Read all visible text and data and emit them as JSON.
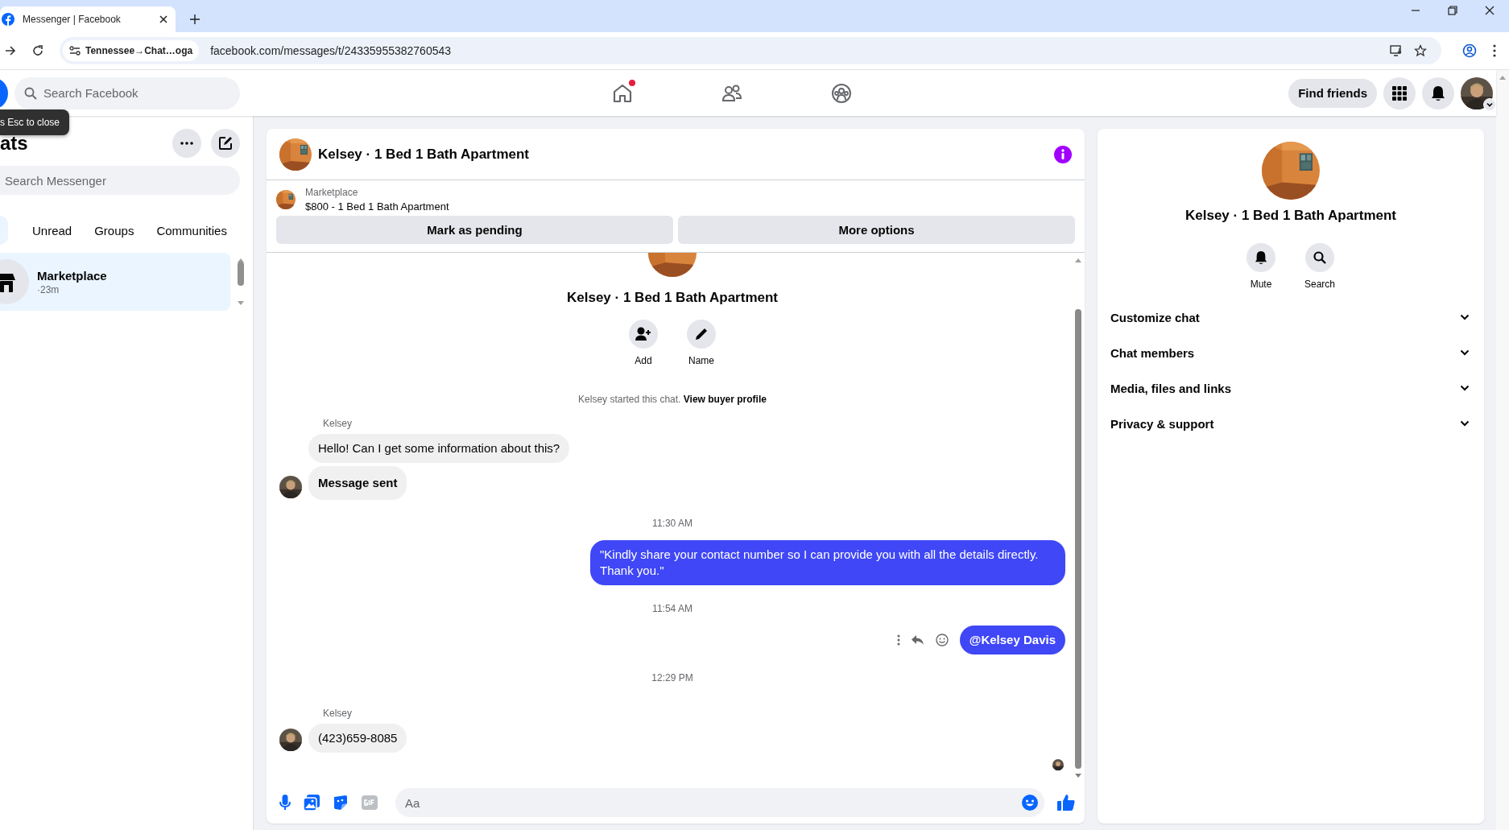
{
  "browser": {
    "tab_title": "Messenger | Facebook",
    "site_chip": "Tennessee→Chat…oga",
    "url": "facebook.com/messages/t/24335955382760543"
  },
  "topbar": {
    "search_placeholder": "Search Facebook",
    "nav": [
      {
        "kind": "home",
        "badge": true
      },
      {
        "kind": "friends",
        "badge": false
      },
      {
        "kind": "groups",
        "badge": false
      }
    ],
    "find_friends": "Find friends"
  },
  "tooltip": "s Esc to close",
  "sidebar": {
    "title": "ats",
    "search_placeholder": "Search Messenger",
    "filters": [
      "Unread",
      "Groups",
      "Communities"
    ],
    "chats": [
      {
        "name": "Marketplace",
        "meta": "·23m",
        "selected": true
      }
    ]
  },
  "conversation": {
    "title": "Kelsey · 1 Bed 1 Bath Apartment",
    "listing": {
      "source": "Marketplace",
      "title": "$800 - 1 Bed 1 Bath Apartment"
    },
    "actions": [
      "Mark as pending",
      "More options"
    ],
    "profile": {
      "name": "Kelsey · 1 Bed 1 Bath Apartment",
      "actions": [
        {
          "kind": "add",
          "label": "Add"
        },
        {
          "kind": "name",
          "label": "Name"
        }
      ]
    },
    "started": {
      "text": "Kelsey started this chat.",
      "link": "View buyer profile"
    },
    "messages": [
      {
        "kind": "sender",
        "text": "Kelsey"
      },
      {
        "kind": "incoming",
        "text": "Hello! Can I get some information about this?",
        "avatar": false,
        "bold": false
      },
      {
        "kind": "incoming",
        "text": "Message sent",
        "avatar": true,
        "bold": true
      },
      {
        "kind": "time",
        "text": "11:30 AM"
      },
      {
        "kind": "outgoing",
        "text": "\"Kindly share your contact number so I can provide you with all the details directly. Thank you.\"",
        "actions": false,
        "bold": false
      },
      {
        "kind": "time",
        "text": "11:54 AM"
      },
      {
        "kind": "outgoing",
        "text": "@Kelsey Davis",
        "actions": true,
        "bold": true
      },
      {
        "kind": "time",
        "text": "12:29 PM"
      },
      {
        "kind": "sender",
        "text": "Kelsey"
      },
      {
        "kind": "incoming",
        "text": "(423)659-8085",
        "avatar": true,
        "bold": false
      }
    ],
    "composer_placeholder": "Aa"
  },
  "details": {
    "name": "Kelsey · 1 Bed 1 Bath Apartment",
    "actions": [
      {
        "kind": "mute",
        "label": "Mute"
      },
      {
        "kind": "search",
        "label": "Search"
      }
    ],
    "sections": [
      "Customize chat",
      "Chat members",
      "Media, files and links",
      "Privacy & support"
    ]
  }
}
